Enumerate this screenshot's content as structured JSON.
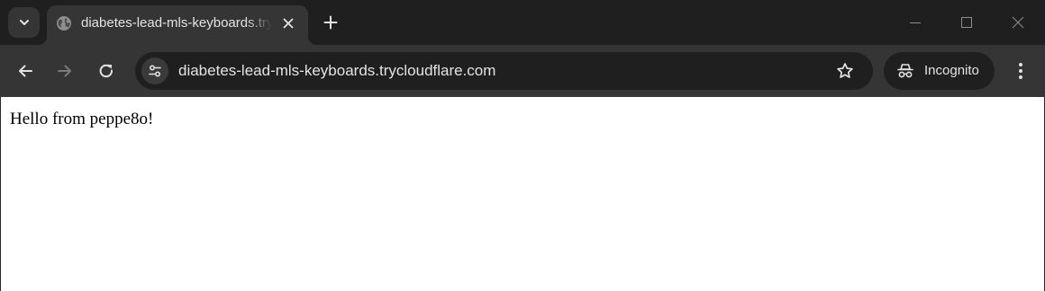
{
  "colors": {
    "tabstrip_bg": "#1f1f1f",
    "toolbar_bg": "#353535",
    "omnibox_bg": "#1f1f1f",
    "text_light": "#e3e3e3",
    "icon_muted": "#8e8e8e",
    "page_bg": "#ffffff"
  },
  "tabs": [
    {
      "title": "diabetes-lead-mls-keyboards.trycloudflare.com",
      "favicon": "globe-icon",
      "active": true
    }
  ],
  "toolbar": {
    "url": "diabetes-lead-mls-keyboards.trycloudflare.com",
    "incognito_label": "Incognito"
  },
  "icons": {
    "tab_search": "chevron-down-icon",
    "tab_close": "close-icon",
    "new_tab": "plus-icon",
    "minimize": "minimize-icon",
    "maximize": "maximize-icon",
    "close_window": "close-icon",
    "back": "arrow-left-icon",
    "forward": "arrow-right-icon",
    "reload": "reload-icon",
    "site_info": "tune-icon",
    "bookmark": "star-icon",
    "incognito": "incognito-icon",
    "menu": "more-vertical-icon"
  },
  "page": {
    "body_text": "Hello from peppe8o!"
  }
}
